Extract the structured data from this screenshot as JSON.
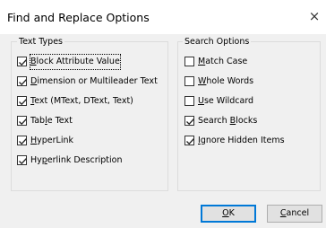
{
  "window": {
    "title": "Find and Replace Options",
    "close_glyph": "×"
  },
  "text_types": {
    "legend": "Text Types",
    "items": [
      {
        "pre": "",
        "u": "B",
        "post": "lock Attribute Value",
        "checked": true
      },
      {
        "pre": "",
        "u": "D",
        "post": "imension or Multileader Text",
        "checked": true
      },
      {
        "pre": "",
        "u": "T",
        "post": "ext (MText, DText, Text)",
        "checked": true
      },
      {
        "pre": "Tab",
        "u": "l",
        "post": "e Text",
        "checked": true
      },
      {
        "pre": "",
        "u": "H",
        "post": "yperLink",
        "checked": true
      },
      {
        "pre": "Hy",
        "u": "p",
        "post": "erlink Description",
        "checked": true
      }
    ]
  },
  "search_options": {
    "legend": "Search Options",
    "items": [
      {
        "pre": "",
        "u": "M",
        "post": "atch Case",
        "checked": false
      },
      {
        "pre": "",
        "u": "W",
        "post": "hole Words",
        "checked": false
      },
      {
        "pre": "",
        "u": "U",
        "post": "se Wildcard",
        "checked": false
      },
      {
        "pre": "Search ",
        "u": "B",
        "post": "locks",
        "checked": true
      },
      {
        "pre": "",
        "u": "I",
        "post": "gnore Hidden Items",
        "checked": true
      }
    ]
  },
  "buttons": {
    "ok": {
      "u": "O",
      "post": "K"
    },
    "cancel": {
      "u": "C",
      "post": "ancel"
    }
  }
}
